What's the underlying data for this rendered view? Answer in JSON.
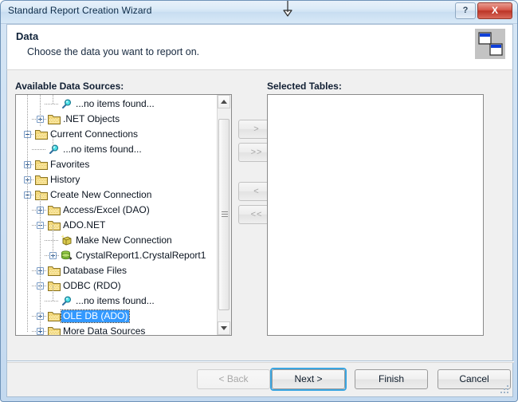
{
  "window": {
    "title": "Standard Report Creation Wizard",
    "help_label": "?",
    "close_label": "X"
  },
  "header": {
    "title": "Data",
    "subtitle": "Choose the data you want to report on.",
    "icon": "data-link-icon"
  },
  "panels": {
    "available_label": "Available Data Sources:",
    "selected_label": "Selected Tables:",
    "selected_items": []
  },
  "transfer_buttons": [
    {
      "name": "add-button",
      "label": ">",
      "enabled": false
    },
    {
      "name": "add-all-button",
      "label": ">>",
      "enabled": false
    },
    {
      "name": "remove-button",
      "label": "<",
      "enabled": false
    },
    {
      "name": "remove-all-button",
      "label": "<<",
      "enabled": false
    }
  ],
  "tree": {
    "items": [
      {
        "label": "...no items found...",
        "indent": 3,
        "icon": "magnifier-icon",
        "expander": "none",
        "selected": false
      },
      {
        "label": ".NET Objects",
        "indent": 2,
        "icon": "folder-icon",
        "expander": "plus",
        "selected": false
      },
      {
        "label": "Current Connections",
        "indent": 1,
        "icon": "folder-icon",
        "expander": "minus",
        "selected": false
      },
      {
        "label": "...no items found...",
        "indent": 2,
        "icon": "magnifier-icon",
        "expander": "none",
        "selected": false
      },
      {
        "label": "Favorites",
        "indent": 1,
        "icon": "folder-icon",
        "expander": "plus",
        "selected": false
      },
      {
        "label": "History",
        "indent": 1,
        "icon": "folder-icon",
        "expander": "plus",
        "selected": false
      },
      {
        "label": "Create New Connection",
        "indent": 1,
        "icon": "folder-icon",
        "expander": "minus",
        "selected": false
      },
      {
        "label": "Access/Excel (DAO)",
        "indent": 2,
        "icon": "folder-icon",
        "expander": "plus",
        "selected": false
      },
      {
        "label": "ADO.NET",
        "indent": 2,
        "icon": "folder-icon",
        "expander": "minus",
        "selected": false
      },
      {
        "label": "Make New Connection",
        "indent": 3,
        "icon": "new-connection-icon",
        "expander": "none",
        "selected": false
      },
      {
        "label": "CrystalReport1.CrystalReport1",
        "indent": 3,
        "icon": "dataset-icon",
        "expander": "plus",
        "selected": false
      },
      {
        "label": "Database Files",
        "indent": 2,
        "icon": "folder-icon",
        "expander": "plus",
        "selected": false
      },
      {
        "label": "ODBC (RDO)",
        "indent": 2,
        "icon": "folder-icon",
        "expander": "minus",
        "selected": false
      },
      {
        "label": "...no items found...",
        "indent": 3,
        "icon": "magnifier-icon",
        "expander": "none",
        "selected": false
      },
      {
        "label": "OLE DB (ADO)",
        "indent": 2,
        "icon": "folder-icon",
        "expander": "plus",
        "selected": true
      },
      {
        "label": "More Data Sources",
        "indent": 2,
        "icon": "folder-icon",
        "expander": "plus",
        "selected": false
      }
    ]
  },
  "footer_buttons": [
    {
      "name": "back-button",
      "label": "< Back",
      "enabled": false,
      "focused": false
    },
    {
      "name": "next-button",
      "label": "Next >",
      "enabled": true,
      "focused": true
    },
    {
      "name": "finish-button",
      "label": "Finish",
      "enabled": true,
      "focused": false
    },
    {
      "name": "cancel-button",
      "label": "Cancel",
      "enabled": true,
      "focused": false
    }
  ],
  "colors": {
    "selection_blue": "#3399FF",
    "focus_ring": "#3AA5E0",
    "close_red": "#BC3427",
    "folder_yellow": "#FFE07A",
    "magnifier_cyan": "#2FD8E0"
  },
  "cursor": {
    "type": "vertical-resize-arrow"
  }
}
